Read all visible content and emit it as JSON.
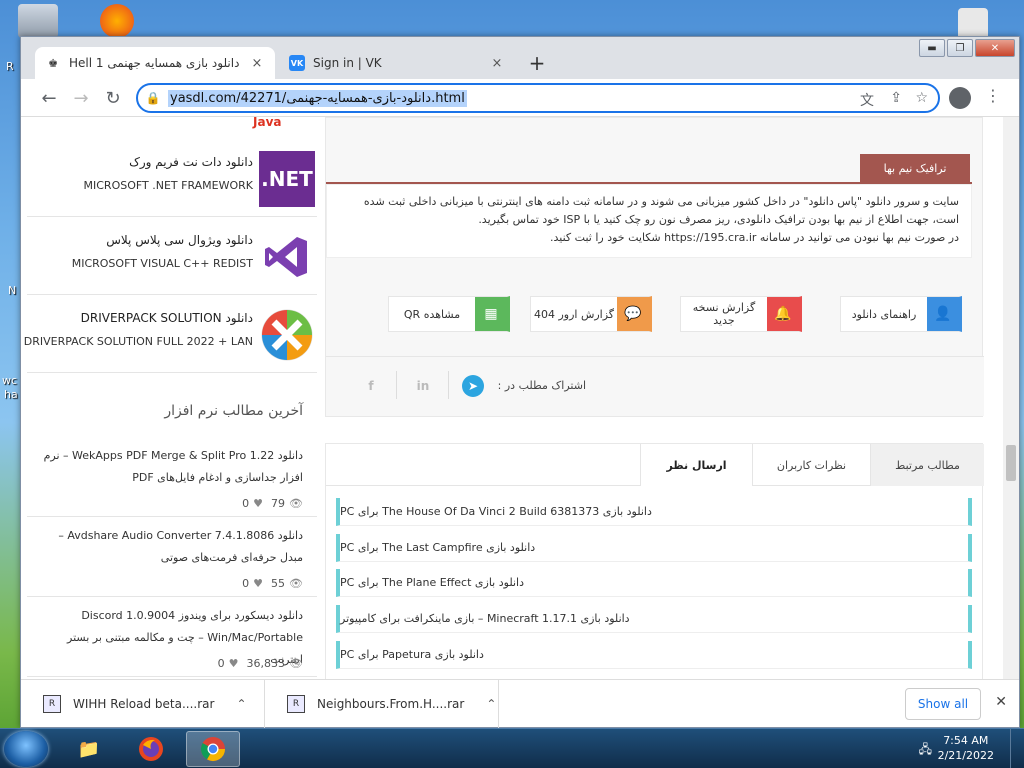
{
  "desktop": {
    "fragments": [
      "R",
      "N",
      "wc",
      "ha"
    ]
  },
  "browser": {
    "tabs": [
      {
        "title": "دانلود بازی همسایه جهنمی 1 Hell",
        "close": "×",
        "active": true
      },
      {
        "title": "Sign in | VK",
        "close": "×",
        "favicon": "VK",
        "active": false
      }
    ],
    "new_tab": "+",
    "window_controls": {
      "minimize": "▬",
      "maximize": "❐",
      "close": "✕"
    },
    "nav": {
      "back": "←",
      "forward": "→",
      "reload": "↻"
    },
    "url": "yasdl.com/42271/دانلود-بازی-همسایه-جهنمی.html",
    "url_icons": [
      "translate-icon",
      "share-icon",
      "star-icon"
    ],
    "menu": "⋮"
  },
  "sidebar": {
    "top_fragment": "Java",
    "software": [
      {
        "name": "دانلود دات نت فریم ورک",
        "sub": "MICROSOFT .NET FRAMEWORK",
        "logo": ".NET"
      },
      {
        "name": "دانلود ویژوال سی پلاس پلاس",
        "sub": "MICROSOFT VISUAL C++ REDIST",
        "logo": "VS"
      },
      {
        "name": "دانلود DRIVERPACK SOLUTION",
        "sub": "DRIVERPACK SOLUTION FULL 2022 + LAN",
        "logo": "DP"
      }
    ],
    "latest_heading": "آخرین مطالب نرم افزار",
    "posts": [
      {
        "title": "دانلود WekApps PDF Merge & Split Pro 1.22 – نرم افزار جداسازی و ادغام فایل‌های PDF",
        "views": "79",
        "likes": "0"
      },
      {
        "title": "دانلود Avdshare Audio Converter 7.4.1.8086 – مبدل حرفه‌ای فرمت‌های صوتی",
        "views": "55",
        "likes": "0"
      },
      {
        "title": "دانلود دیسکورد برای ویندوز Discord 1.0.9004 Win/Mac/Portable – چت و مکالمه مبتنی بر بستر اینترنت",
        "views": "36,833",
        "likes": "0"
      }
    ]
  },
  "main": {
    "traffic_tab": "ترافیک نیم بها",
    "traffic_lines": [
      "سایت و سرور دانلود \"پاس دانلود\" در داخل کشور میزبانی می شوند و در سامانه ثبت دامنه های اینترنتی با میزبانی داخلی ثبت شده",
      "است، جهت اطلاع از نیم بها بودن ترافیک دانلودی، ریز مصرف نون رو چک کنید یا با ISP خود تماس بگیرید.",
      "در صورت نیم بها نبودن می توانید در سامانه https://195.cra.ir شکایت خود را ثبت کنید."
    ],
    "action_buttons": [
      {
        "label": "راهنمای دانلود",
        "color": "#3b8fe0",
        "icon": "user-icon"
      },
      {
        "label": "گزارش نسخه جدید",
        "color": "#e84c4c",
        "icon": "bell-icon"
      },
      {
        "label": "گزارش ارور 404",
        "color": "#f09a4a",
        "icon": "chat-icon"
      },
      {
        "label": "مشاهده QR",
        "color": "#5cb85c",
        "icon": "qr-icon"
      }
    ],
    "share_label": "اشتراک مطلب در :",
    "share_icons": [
      "telegram-icon",
      "linkedin-icon",
      "facebook-icon"
    ],
    "tabs": [
      {
        "label": "مطالب مرتبط",
        "active": true
      },
      {
        "label": "نظرات کاربران",
        "active": false
      },
      {
        "label": "ارسال نظر",
        "active": false
      }
    ],
    "related": [
      "دانلود بازی The House Of Da Vinci 2 Build 6381373 برای PC",
      "دانلود بازی The Last Campfire برای PC",
      "دانلود بازی The Plane Effect برای PC",
      "دانلود بازی Minecraft 1.17.1 – بازی ماینکرافت برای کامپیوتر",
      "دانلود بازی Papetura برای PC"
    ]
  },
  "downloads": {
    "items": [
      {
        "name": "WIHH Reload beta....rar",
        "icon": "R"
      },
      {
        "name": "Neighbours.From.H....rar",
        "icon": "R"
      }
    ],
    "show_all": "Show all",
    "close": "✕"
  },
  "taskbar": {
    "time": "7:54 AM",
    "date": "2/21/2022"
  }
}
